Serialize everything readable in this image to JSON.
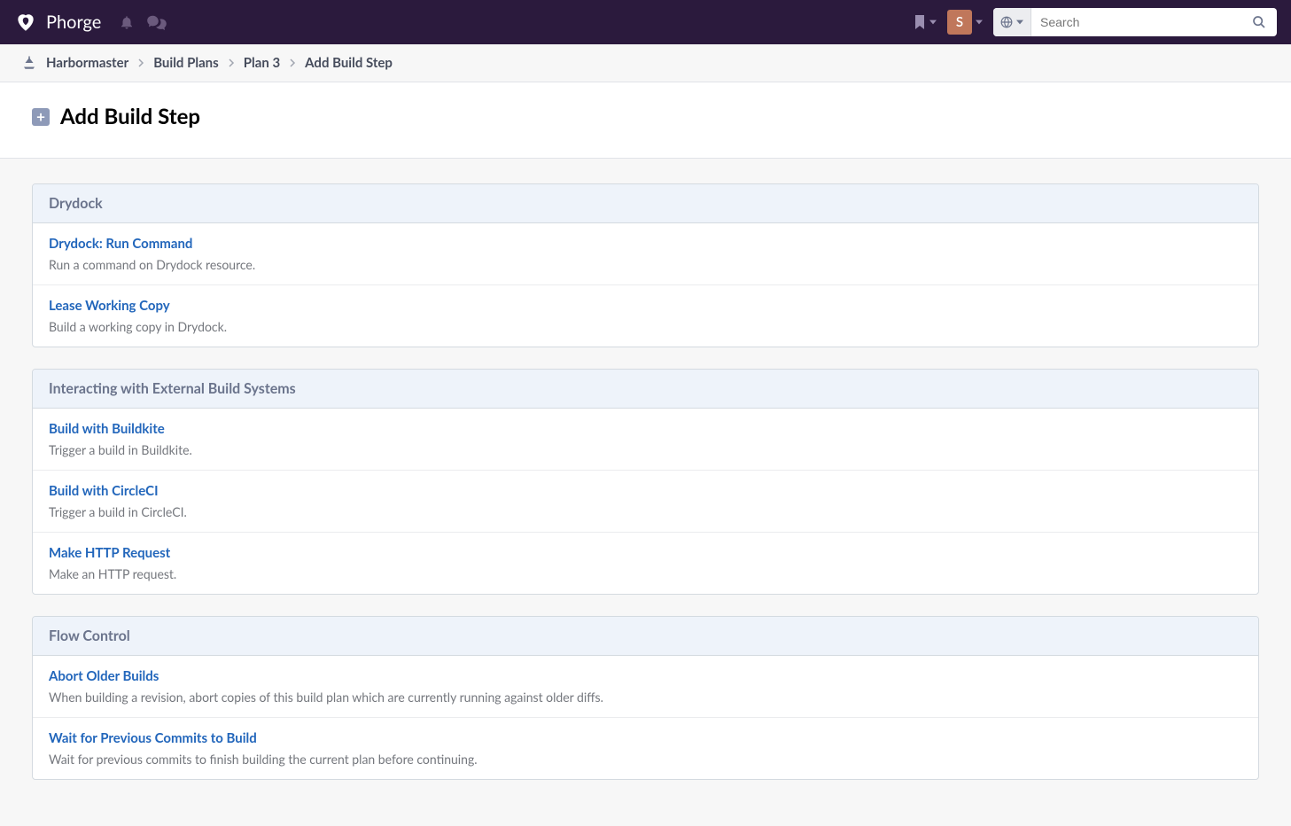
{
  "header": {
    "app_name": "Phorge",
    "user_initial": "S",
    "search_placeholder": "Search"
  },
  "breadcrumb": {
    "items": [
      "Harbormaster",
      "Build Plans",
      "Plan 3",
      "Add Build Step"
    ]
  },
  "page": {
    "title": "Add Build Step"
  },
  "sections": [
    {
      "title": "Drydock",
      "items": [
        {
          "title": "Drydock: Run Command",
          "desc": "Run a command on Drydock resource."
        },
        {
          "title": "Lease Working Copy",
          "desc": "Build a working copy in Drydock."
        }
      ]
    },
    {
      "title": "Interacting with External Build Systems",
      "items": [
        {
          "title": "Build with Buildkite",
          "desc": "Trigger a build in Buildkite."
        },
        {
          "title": "Build with CircleCI",
          "desc": "Trigger a build in CircleCI."
        },
        {
          "title": "Make HTTP Request",
          "desc": "Make an HTTP request."
        }
      ]
    },
    {
      "title": "Flow Control",
      "items": [
        {
          "title": "Abort Older Builds",
          "desc": "When building a revision, abort copies of this build plan which are currently running against older diffs."
        },
        {
          "title": "Wait for Previous Commits to Build",
          "desc": "Wait for previous commits to finish building the current plan before continuing."
        }
      ]
    }
  ]
}
